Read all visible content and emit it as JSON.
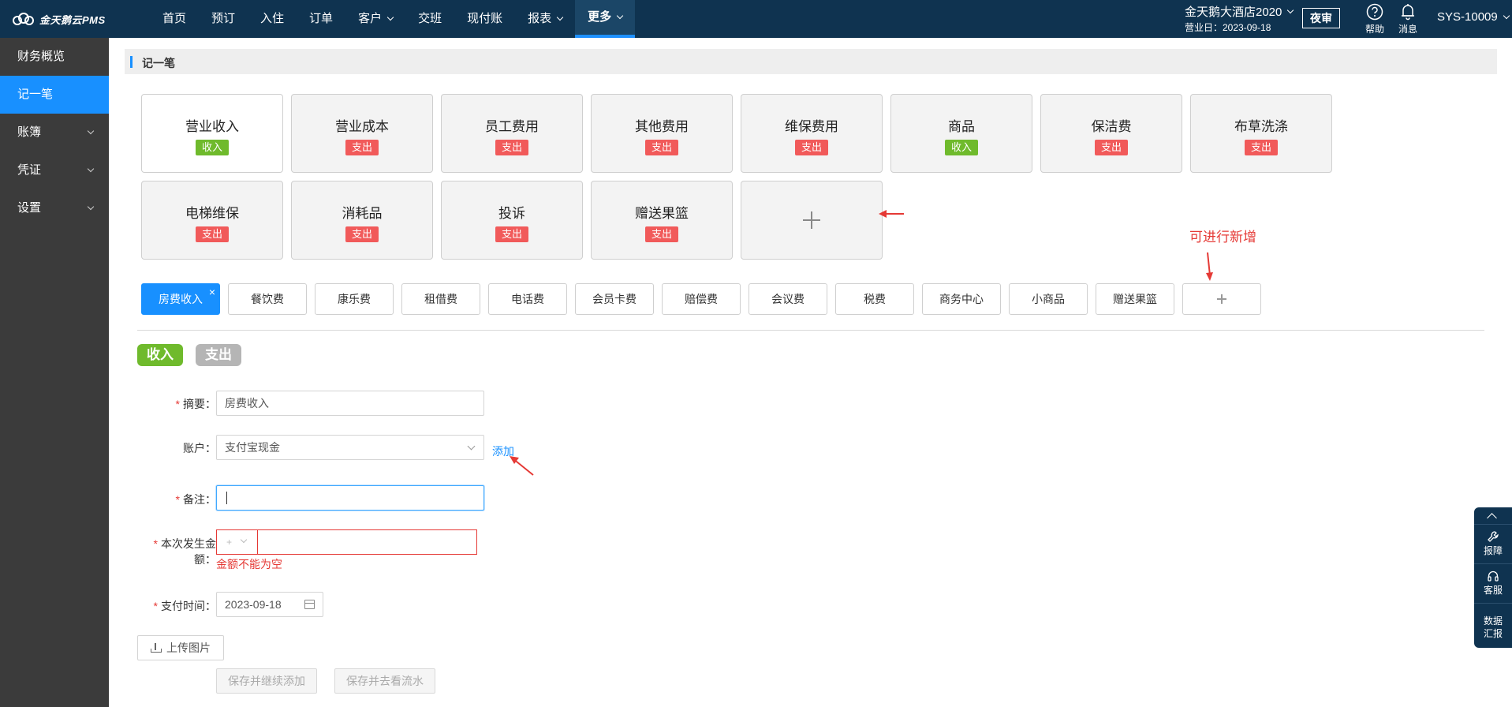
{
  "app": {
    "logo_text": "金天鹅云PMS"
  },
  "nav": {
    "items": [
      {
        "label": "首页",
        "dropdown": false
      },
      {
        "label": "预订",
        "dropdown": false
      },
      {
        "label": "入住",
        "dropdown": false
      },
      {
        "label": "订单",
        "dropdown": false
      },
      {
        "label": "客户",
        "dropdown": true
      },
      {
        "label": "交班",
        "dropdown": false
      },
      {
        "label": "现付账",
        "dropdown": false
      },
      {
        "label": "报表",
        "dropdown": true
      },
      {
        "label": "更多",
        "dropdown": true,
        "active": true
      }
    ]
  },
  "header": {
    "hotel_name": "金天鹅大酒店2020",
    "business_date": "营业日：2023-09-18",
    "night_audit_label": "夜审",
    "help_label": "帮助",
    "message_label": "消息",
    "user": "SYS-10009"
  },
  "sidebar": {
    "items": [
      {
        "label": "财务概览",
        "expandable": false
      },
      {
        "label": "记一笔",
        "expandable": false,
        "active": true
      },
      {
        "label": "账簿",
        "expandable": true
      },
      {
        "label": "凭证",
        "expandable": true
      },
      {
        "label": "设置",
        "expandable": true
      }
    ]
  },
  "section": {
    "title": "记一笔"
  },
  "categories": [
    {
      "name": "营业收入",
      "badge": "收入",
      "type": "in"
    },
    {
      "name": "营业成本",
      "badge": "支出",
      "type": "out"
    },
    {
      "name": "员工费用",
      "badge": "支出",
      "type": "out"
    },
    {
      "name": "其他费用",
      "badge": "支出",
      "type": "out"
    },
    {
      "name": "维保费用",
      "badge": "支出",
      "type": "out"
    },
    {
      "name": "商品",
      "badge": "收入",
      "type": "in"
    },
    {
      "name": "保洁费",
      "badge": "支出",
      "type": "out"
    },
    {
      "name": "布草洗涤",
      "badge": "支出",
      "type": "out"
    },
    {
      "name": "电梯维保",
      "badge": "支出",
      "type": "out"
    },
    {
      "name": "消耗品",
      "badge": "支出",
      "type": "out"
    },
    {
      "name": "投诉",
      "badge": "支出",
      "type": "out"
    },
    {
      "name": "赠送果篮",
      "badge": "支出",
      "type": "out"
    }
  ],
  "annotation": {
    "add_hint": "可进行新增"
  },
  "sub_tags": {
    "items": [
      "房费收入",
      "餐饮费",
      "康乐费",
      "租借费",
      "电话费",
      "会员卡费",
      "赔偿费",
      "会议费",
      "税费",
      "商务中心",
      "小商品",
      "赠送果篮"
    ],
    "close_glyph": "×"
  },
  "type_toggle": {
    "income": "收入",
    "expense": "支出"
  },
  "form": {
    "summary": {
      "label": "摘要：",
      "value": "房费收入"
    },
    "account": {
      "label": "账户：",
      "value": "支付宝现金",
      "add_link": "添加"
    },
    "remark": {
      "label": "备注：",
      "value": ""
    },
    "amount": {
      "label": "本次发生金额：",
      "sign": "+",
      "error": "金额不能为空"
    },
    "pay_time": {
      "label": "支付时间：",
      "value": "2023-09-18"
    },
    "upload_label": "上传图片",
    "save_continue": "保存并继续添加",
    "save_view": "保存并去看流水"
  },
  "float_panel": {
    "items": [
      "报障",
      "客服",
      "数据汇报"
    ]
  },
  "colors": {
    "topbar": "#0f3350",
    "sidebar": "#3b3b3b",
    "accent": "#1890ff",
    "income": "#6fba2c",
    "expense": "#f15a5a",
    "error": "#e53935"
  }
}
